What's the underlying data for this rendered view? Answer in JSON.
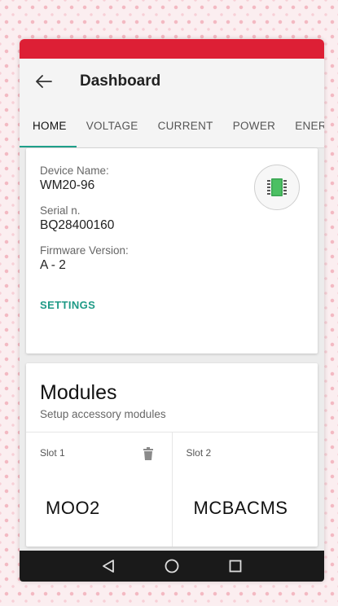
{
  "app_bar": {
    "title": "Dashboard"
  },
  "tabs": [
    "HOME",
    "VOLTAGE",
    "CURRENT",
    "POWER",
    "ENER"
  ],
  "device": {
    "name_label": "Device Name:",
    "name_value": "WM20-96",
    "serial_label": "Serial n.",
    "serial_value": "BQ28400160",
    "firmware_label": "Firmware Version:",
    "firmware_value": "A - 2",
    "settings_label": "SETTINGS",
    "icon": "chip-icon"
  },
  "modules": {
    "title": "Modules",
    "subtitle": "Setup accessory modules",
    "slots": [
      {
        "label": "Slot 1",
        "name": "MOO2",
        "icon": "trash-icon"
      },
      {
        "label": "Slot 2",
        "name": "MCBACMS"
      }
    ]
  },
  "nav": {
    "back": "back-triangle-icon",
    "home": "home-circle-icon",
    "recents": "recents-square-icon"
  },
  "colors": {
    "status_bar": "#dd1f35",
    "accent": "#1ea08a",
    "nav_bar": "#1a1a1a"
  }
}
